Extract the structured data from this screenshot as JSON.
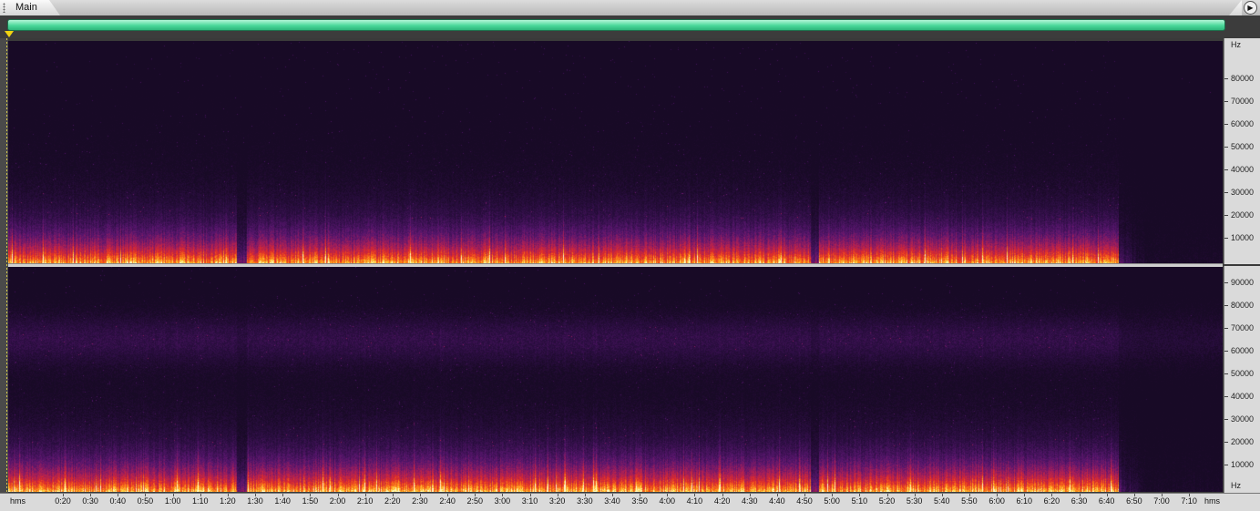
{
  "tabs": {
    "main_label": "Main"
  },
  "icons": {
    "grip": "grip-icon",
    "nav": "play-arrow-icon",
    "playhead": "playhead-marker-icon"
  },
  "colors": {
    "selection_bar": "#4ad89a",
    "playhead": "#f2d411",
    "ruler_bg": "#dadada"
  },
  "frequency_ruler": {
    "unit": "Hz",
    "channel1_labels": [
      "80000",
      "70000",
      "60000",
      "50000",
      "40000",
      "30000",
      "20000",
      "10000"
    ],
    "channel2_labels": [
      "90000",
      "80000",
      "70000",
      "60000",
      "50000",
      "40000",
      "30000",
      "20000",
      "10000"
    ]
  },
  "time_ruler": {
    "unit": "hms",
    "labels": [
      "0:20",
      "0:30",
      "0:40",
      "0:50",
      "1:00",
      "1:10",
      "1:20",
      "1:30",
      "1:40",
      "1:50",
      "2:00",
      "2:10",
      "2:20",
      "2:30",
      "2:40",
      "2:50",
      "3:00",
      "3:10",
      "3:20",
      "3:30",
      "3:40",
      "3:50",
      "4:00",
      "4:10",
      "4:20",
      "4:30",
      "4:40",
      "4:50",
      "5:00",
      "5:10",
      "5:20",
      "5:30",
      "5:40",
      "5:50",
      "6:00",
      "6:10",
      "6:20",
      "6:30",
      "6:40",
      "6:50",
      "7:00",
      "7:10"
    ]
  }
}
